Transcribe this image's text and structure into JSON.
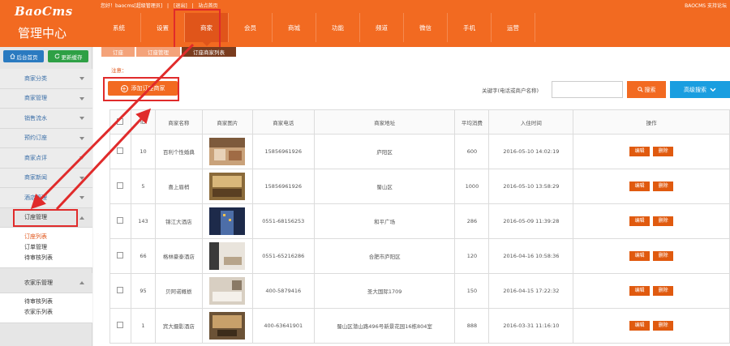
{
  "logo": {
    "brand": "BaoCms",
    "subtitle": "管理中心"
  },
  "topinfo": {
    "greeting": "您好！baocms[超级管理员]",
    "sep1": "|",
    "logout": "[退出]",
    "sep2": "|",
    "home": "站点首页"
  },
  "topright": {
    "forum": "BAOCMS 支持论坛"
  },
  "nav": [
    {
      "label": "系统"
    },
    {
      "label": "设置"
    },
    {
      "label": "商家"
    },
    {
      "label": "会员"
    },
    {
      "label": "商城"
    },
    {
      "label": "功能"
    },
    {
      "label": "频道"
    },
    {
      "label": "微信"
    },
    {
      "label": "手机"
    },
    {
      "label": "运营"
    }
  ],
  "sidebar": {
    "home_btn": "后台首页",
    "cache_btn": "更新缓存",
    "items": [
      {
        "label": "商家分类"
      },
      {
        "label": "商家管理"
      },
      {
        "label": "销售流水"
      },
      {
        "label": "预约订座"
      },
      {
        "label": "商家点评"
      },
      {
        "label": "商家新闻"
      },
      {
        "label": "酒店管理"
      },
      {
        "label": "订座管理"
      }
    ],
    "submenu1": [
      {
        "label": "订座列表"
      },
      {
        "label": "订单管理"
      },
      {
        "label": "待审核列表"
      }
    ],
    "group2": {
      "label": "农家乐管理"
    },
    "submenu2": [
      {
        "label": "待审核列表"
      },
      {
        "label": "农家乐列表"
      }
    ]
  },
  "breadcrumbs": [
    {
      "label": "订座"
    },
    {
      "label": "订座管理"
    },
    {
      "label": "订座商家列表"
    }
  ],
  "notice": "注意：",
  "add_button": "添加订座商家",
  "search": {
    "label": "关键字(电话或商户名称)",
    "placeholder": "",
    "button": "搜索",
    "advanced": "高级搜索"
  },
  "table": {
    "headers": [
      "",
      "ID",
      "商家名称",
      "商家图片",
      "商家电话",
      "商家地址",
      "平均消费",
      "入住时间",
      "操作"
    ],
    "rows": [
      {
        "id": "10",
        "name": "百利个性婚典",
        "phone": "15856961926",
        "address": "庐阳区",
        "avg": "600",
        "time": "2016-05-10 14:02:19"
      },
      {
        "id": "5",
        "name": "喜上眉梢",
        "phone": "15856961926",
        "address": "蜀山区",
        "avg": "1000",
        "time": "2016-05-10 13:58:29"
      },
      {
        "id": "143",
        "name": "锦江大酒店",
        "phone": "0551-68156253",
        "address": "和平广场",
        "avg": "286",
        "time": "2016-05-09 11:39:28"
      },
      {
        "id": "66",
        "name": "格林豪泰酒店",
        "phone": "0551-65216286",
        "address": "合肥市庐阳区",
        "avg": "120",
        "time": "2016-04-16 10:58:36"
      },
      {
        "id": "95",
        "name": "贝阿诺概栃",
        "phone": "400-5879416",
        "address": "圣大国际1709",
        "avg": "150",
        "time": "2016-04-15 17:22:32"
      },
      {
        "id": "1",
        "name": "宾大摄影酒店",
        "phone": "400-63641901",
        "address": "蜀山区潜山路496号新景花园16栋804室",
        "avg": "888",
        "time": "2016-03-31 11:16:10"
      }
    ],
    "edit_label": "编辑",
    "delete_label": "删除"
  },
  "colors": {
    "brand": "#f26a21",
    "link": "#3b6fa8",
    "annotation": "#e02b2b",
    "advanced": "#1a9ee0"
  }
}
